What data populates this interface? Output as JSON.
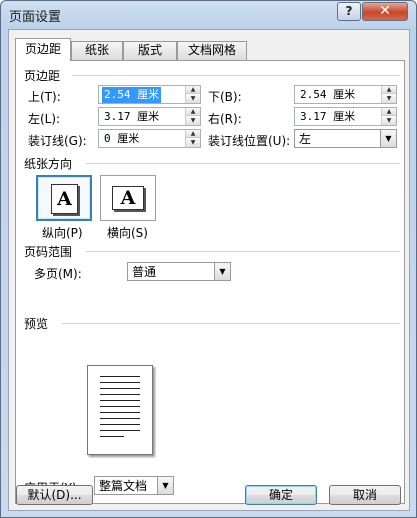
{
  "window": {
    "title": "页面设置",
    "help_glyph": "?",
    "close_glyph": "✕"
  },
  "tabs": [
    {
      "label": "页边距",
      "active": true
    },
    {
      "label": "纸张",
      "active": false
    },
    {
      "label": "版式",
      "active": false
    },
    {
      "label": "文档网格",
      "active": false
    }
  ],
  "margins": {
    "section": "页边距",
    "top": {
      "label": "上(T):",
      "value": "2.54 厘米"
    },
    "bottom": {
      "label": "下(B):",
      "value": "2.54 厘米"
    },
    "left": {
      "label": "左(L):",
      "value": "3.17 厘米"
    },
    "right": {
      "label": "右(R):",
      "value": "3.17 厘米"
    },
    "gutter": {
      "label": "装订线(G):",
      "value": "0 厘米"
    },
    "gutter_pos": {
      "label": "装订线位置(U):",
      "value": "左"
    }
  },
  "orientation": {
    "section": "纸张方向",
    "glyph": "A",
    "portrait": "纵向(P)",
    "landscape": "横向(S)",
    "selected": "portrait"
  },
  "pages": {
    "section": "页码范围",
    "multiple_label": "多页(M):",
    "multiple_value": "普通"
  },
  "preview": {
    "section": "预览",
    "apply_label": "应用于(Y):",
    "apply_value": "整篇文档"
  },
  "buttons": {
    "default": "默认(D)...",
    "ok": "确定",
    "cancel": "取消"
  },
  "icons": {
    "dropdown": "▼",
    "spin_up": "▲",
    "spin_down": "▼"
  }
}
